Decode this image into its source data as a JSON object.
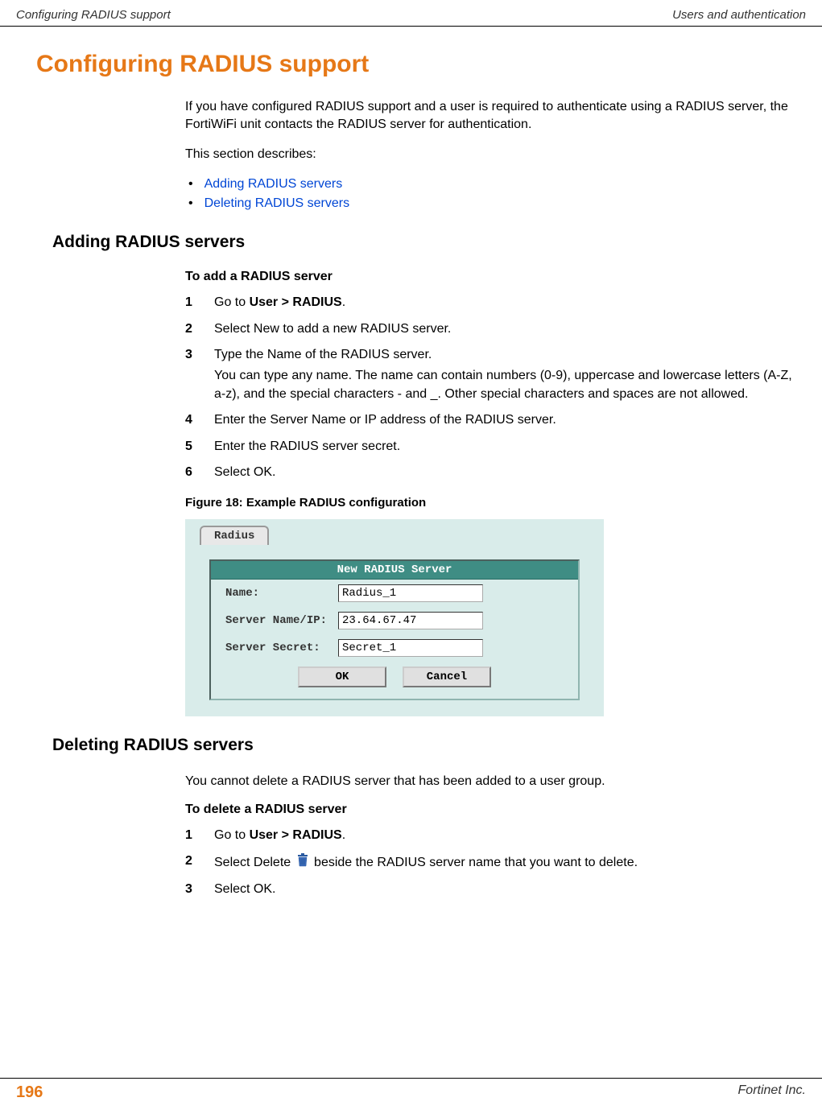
{
  "header": {
    "left": "Configuring RADIUS support",
    "right": "Users and authentication"
  },
  "section_title": "Configuring RADIUS support",
  "intro_p1": "If you have configured RADIUS support and a user is required to authenticate using a RADIUS server, the FortiWiFi unit contacts the RADIUS server for authentication.",
  "intro_p2": "This section describes:",
  "bullets": {
    "b1": "Adding RADIUS servers",
    "b2": "Deleting RADIUS servers"
  },
  "sub1_title": "Adding RADIUS servers",
  "proc1_title": "To add a RADIUS server",
  "steps1": {
    "s1": {
      "num": "1",
      "pre": "Go to ",
      "bold": "User > RADIUS",
      "post": "."
    },
    "s2": {
      "num": "2",
      "text": "Select New to add a new RADIUS server."
    },
    "s3": {
      "num": "3",
      "text": "Type the Name of the RADIUS server.",
      "sub": "You can type any name. The name can contain numbers (0-9), uppercase and lowercase letters (A-Z, a-z), and the special characters - and _. Other special characters and spaces are not allowed."
    },
    "s4": {
      "num": "4",
      "text": "Enter the Server Name or IP address of the RADIUS server."
    },
    "s5": {
      "num": "5",
      "text": "Enter the RADIUS server secret."
    },
    "s6": {
      "num": "6",
      "text": "Select OK."
    }
  },
  "figure_caption": "Figure 18: Example RADIUS configuration",
  "dialog": {
    "tab": "Radius",
    "panel_title": "New RADIUS Server",
    "name_label": "Name:",
    "name_value": "Radius_1",
    "server_label": "Server Name/IP:",
    "server_value": "23.64.67.47",
    "secret_label": "Server Secret:",
    "secret_value": "Secret_1",
    "ok": "OK",
    "cancel": "Cancel"
  },
  "sub2_title": "Deleting RADIUS servers",
  "del_intro": "You cannot delete a RADIUS server that has been added to a user group.",
  "proc2_title": "To delete a RADIUS server",
  "steps2": {
    "s1": {
      "num": "1",
      "pre": "Go to ",
      "bold": "User > RADIUS",
      "post": "."
    },
    "s2": {
      "num": "2",
      "pre": "Select Delete ",
      "post": " beside the RADIUS server name that you want to delete."
    },
    "s3": {
      "num": "3",
      "text": "Select OK."
    }
  },
  "footer": {
    "page": "196",
    "company": "Fortinet Inc."
  }
}
